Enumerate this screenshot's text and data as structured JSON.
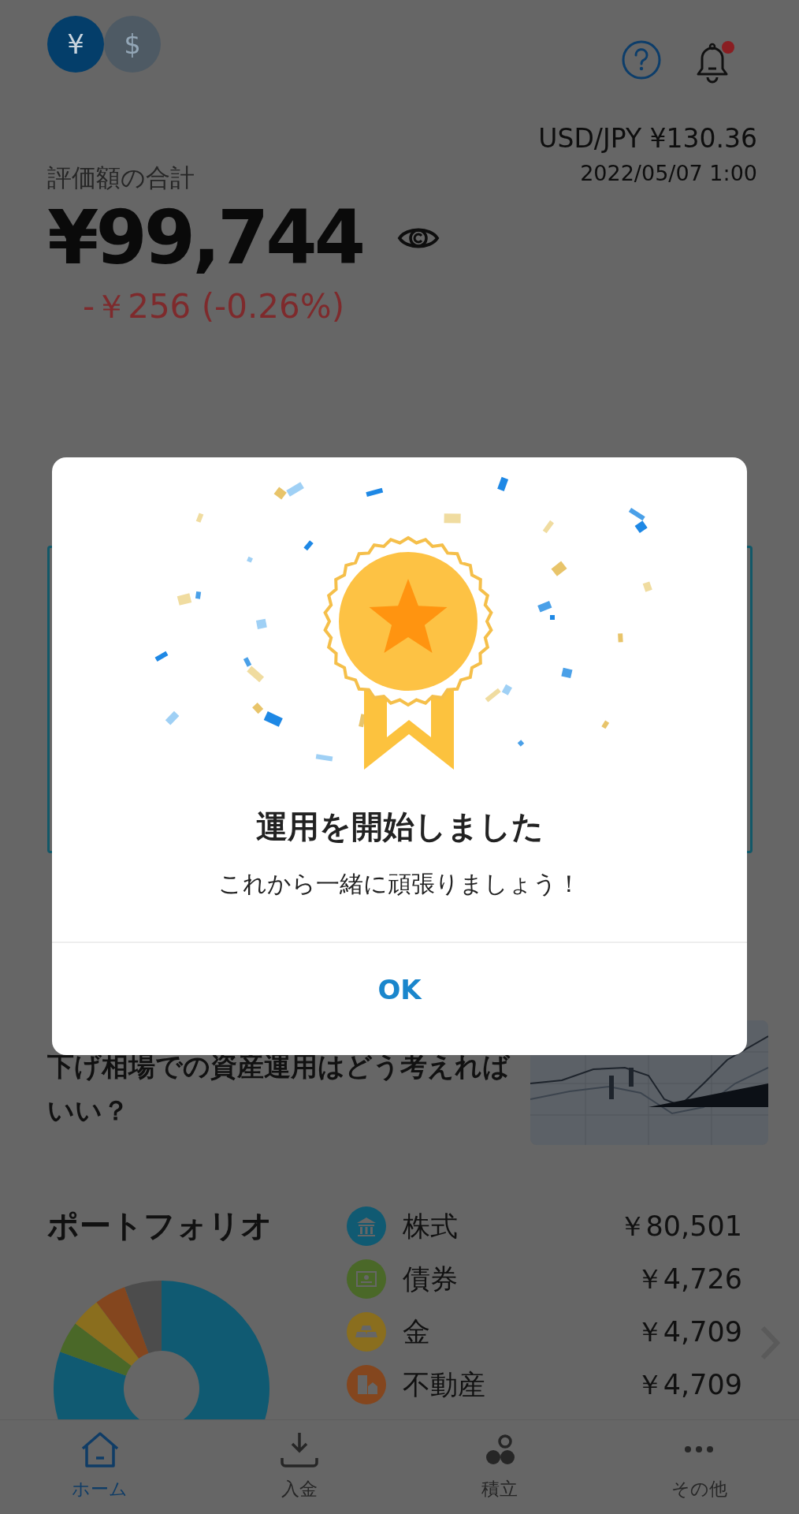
{
  "header": {
    "currencies": [
      {
        "symbol": "¥",
        "selected": true
      },
      {
        "symbol": "$",
        "selected": false
      }
    ],
    "has_notification": true
  },
  "rate": {
    "pair": "USD/JPY ¥130.36",
    "time": "2022/05/07 1:00"
  },
  "total": {
    "label": "評価額の合計",
    "amount": "¥99,744",
    "change": "-￥256 (-0.26%)"
  },
  "article": {
    "title": "下げ相場での資産運用はどう考えればいい？"
  },
  "portfolio": {
    "title": "ポートフォリオ",
    "items": [
      {
        "kind": "stock",
        "name": "株式",
        "value": "￥80,501",
        "color": "#105a72"
      },
      {
        "kind": "bond",
        "name": "債券",
        "value": "￥4,726",
        "color": "#4a6828"
      },
      {
        "kind": "gold",
        "name": "金",
        "value": "￥4,709",
        "color": "#8a6e1e"
      },
      {
        "kind": "real_estate",
        "name": "不動産",
        "value": "￥4,709",
        "color": "#84461e"
      }
    ]
  },
  "nav": [
    {
      "kind": "home",
      "label": "ホーム",
      "selected": true
    },
    {
      "kind": "deposit",
      "label": "入金",
      "selected": false
    },
    {
      "kind": "savings",
      "label": "積立",
      "selected": false
    },
    {
      "kind": "more",
      "label": "その他",
      "selected": false
    }
  ],
  "dialog": {
    "title": "運用を開始しました",
    "message": "これから一緒に頑張りましょう！",
    "button": "OK"
  }
}
